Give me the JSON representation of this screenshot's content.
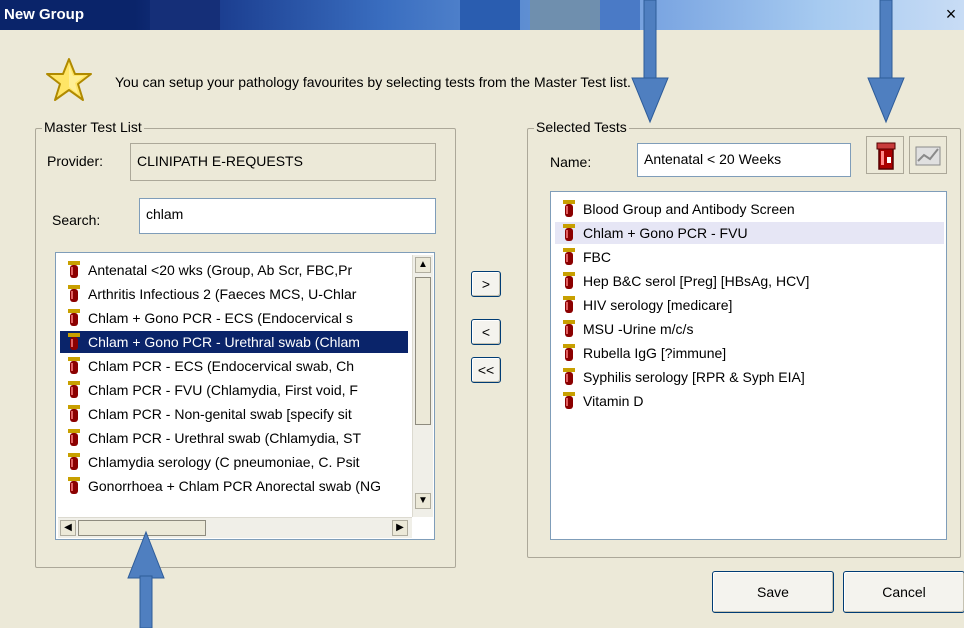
{
  "window": {
    "title": "New Group",
    "close_label": "×"
  },
  "intro_text": "You can setup your pathology favourites by selecting tests from the Master Test list.",
  "master": {
    "legend": "Master Test List",
    "provider_label": "Provider:",
    "provider_value": "CLINIPATH E-REQUESTS",
    "search_label": "Search:",
    "search_value": "chlam",
    "items": [
      "Antenatal <20 wks (Group, Ab Scr, FBC,Pr",
      "Arthritis Infectious 2 (Faeces MCS, U-Chlar",
      "Chlam + Gono PCR - ECS (Endocervical s",
      "Chlam + Gono PCR - Urethral swab (Chlam",
      "Chlam PCR - ECS (Endocervical swab, Ch",
      "Chlam PCR - FVU (Chlamydia, First void, F",
      "Chlam PCR - Non-genital swab [specify sit",
      "Chlam PCR - Urethral swab (Chlamydia, ST",
      "Chlamydia serology (C pneumoniae, C. Psit",
      "Gonorrhoea + Chlam PCR Anorectal swab (NG"
    ],
    "selected_index": 3
  },
  "transfer": {
    "add": ">",
    "remove": "<",
    "remove_all": "<<"
  },
  "selected": {
    "legend": "Selected Tests",
    "name_label": "Name:",
    "name_value": "Antenatal < 20 Weeks",
    "items": [
      "Blood Group and Antibody Screen",
      "Chlam + Gono PCR - FVU",
      "FBC",
      "Hep B&C serol [Preg] [HBsAg, HCV]",
      "HIV serology [medicare]",
      "MSU -Urine m/c/s",
      "Rubella IgG [?immune]",
      "Syphilis serology [RPR & Syph EIA]",
      "Vitamin D"
    ],
    "highlight_index": 1
  },
  "buttons": {
    "save": "Save",
    "cancel": "Cancel"
  },
  "colors": {
    "selection": "#0a246a",
    "arrow": "#4f7fc0",
    "tube": "#8b0000"
  }
}
